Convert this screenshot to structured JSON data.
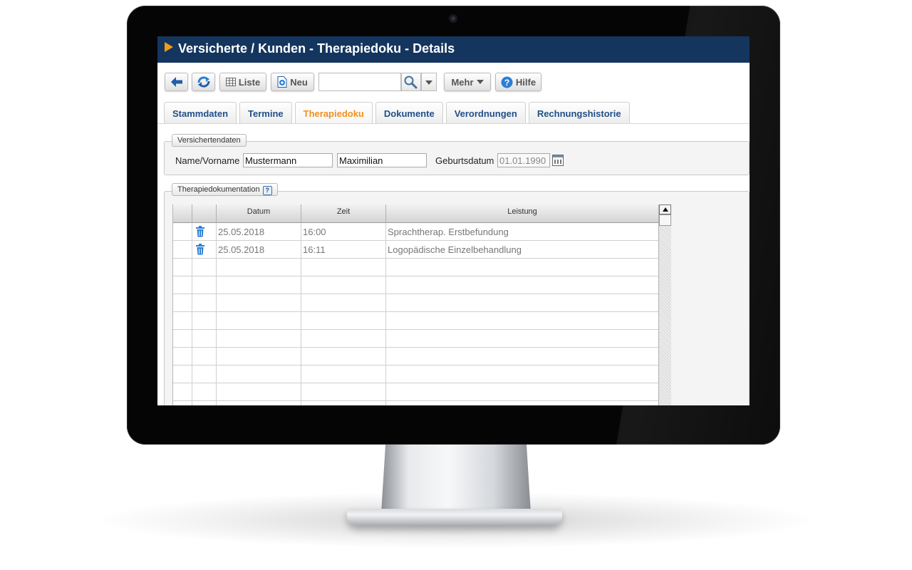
{
  "window": {
    "title": "Versicherte / Kunden - Therapiedoku - Details"
  },
  "toolbar": {
    "list_label": "Liste",
    "new_label": "Neu",
    "search_value": "",
    "more_label": "Mehr",
    "help_label": "Hilfe"
  },
  "tabs": [
    {
      "label": "Stammdaten"
    },
    {
      "label": "Termine"
    },
    {
      "label": "Therapiedoku",
      "active": true
    },
    {
      "label": "Dokumente"
    },
    {
      "label": "Verordnungen"
    },
    {
      "label": "Rechnungshistorie"
    }
  ],
  "insured": {
    "legend": "Versichertendaten",
    "name_label": "Name/Vorname",
    "last_name": "Mustermann",
    "first_name": "Maximilian",
    "birthdate_label": "Geburtsdatum",
    "birthdate": "01.01.1990"
  },
  "therapy": {
    "legend": "Therapiedokumentation",
    "help_mark": "?",
    "columns": [
      "Datum",
      "Zeit",
      "Leistung"
    ],
    "rows": [
      {
        "date": "25.05.2018",
        "time": "16:00",
        "service": "Sprachtherap. Erstbefundung"
      },
      {
        "date": "25.05.2018",
        "time": "16:11",
        "service": "Logopädische Einzelbehandlung"
      }
    ]
  },
  "colors": {
    "title_bar": "#14355e",
    "title_arrow": "#f39a1b",
    "tab_text": "#1f4f88",
    "tab_active": "#f0901e",
    "icon_blue": "#2a7fd4"
  }
}
